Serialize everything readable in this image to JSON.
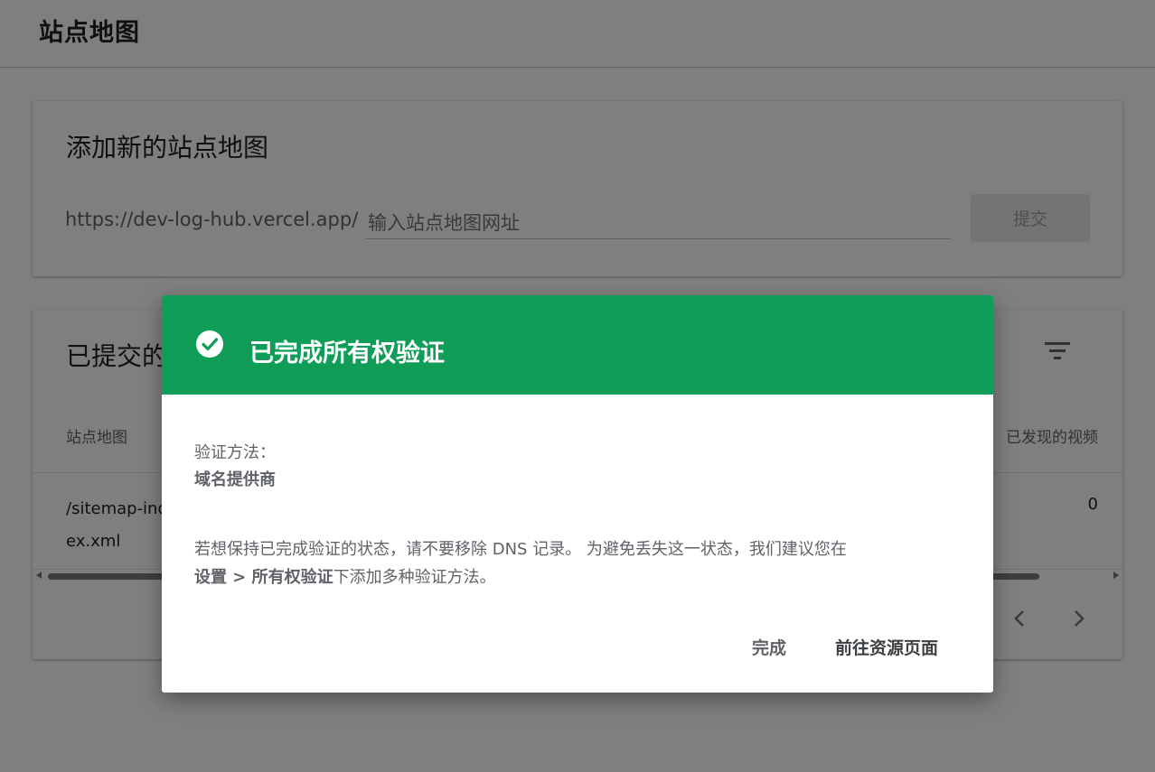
{
  "page": {
    "title": "站点地图"
  },
  "add_card": {
    "title": "添加新的站点地图",
    "url_prefix": "https://dev-log-hub.vercel.app/",
    "input_placeholder": "输入站点地图网址",
    "submit_label": "提交"
  },
  "list_card": {
    "title": "已提交的",
    "columns": {
      "sitemap": "站点地图",
      "videos": "已发现的视频"
    },
    "rows": [
      {
        "sitemap": "/sitemap-index.xml",
        "videos": "0"
      }
    ],
    "icons": {
      "filter": "filter-icon",
      "prev": "chevron-left-icon",
      "next": "chevron-right-icon"
    }
  },
  "dialog": {
    "title": "已完成所有权验证",
    "header_color": "#0f9d58",
    "icon": "check-circle-icon",
    "method_label": "验证方法：",
    "method_value": "域名提供商",
    "message_part1": "若想保持已完成验证的状态，请不要移除 DNS 记录。 为避免丢失这一状态，我们建议您在",
    "message_bold": "设置 > 所有权验证",
    "message_part2": "下添加多种验证方法。",
    "done_label": "完成",
    "goto_label": "前往资源页面"
  }
}
